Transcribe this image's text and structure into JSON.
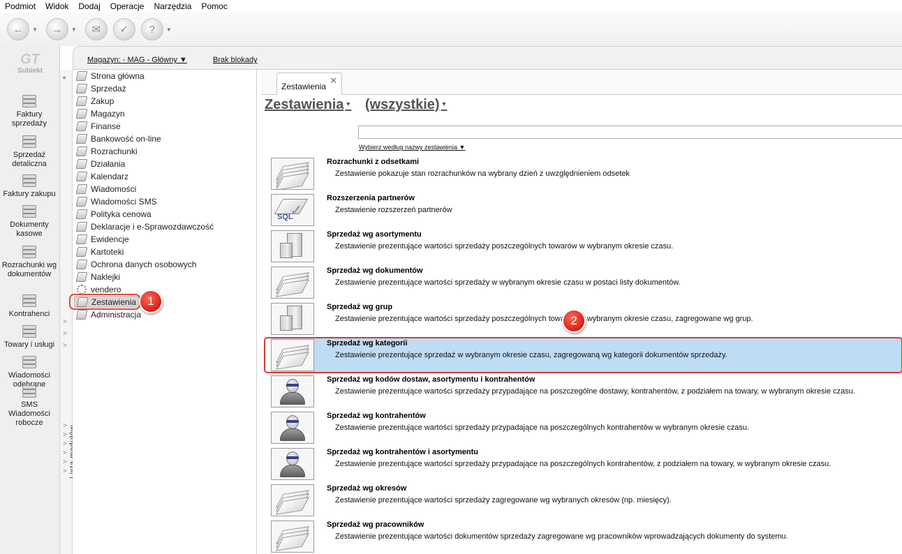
{
  "menu": [
    "Podmiot",
    "Widok",
    "Dodaj",
    "Operacje",
    "Narzędzia",
    "Pomoc"
  ],
  "toolbar": {
    "buttons": [
      {
        "icon": "back-arrow-icon"
      },
      {
        "icon": "forward-arrow-icon"
      },
      {
        "icon": "stamp-icon"
      },
      {
        "icon": "document-check-icon"
      },
      {
        "icon": "help-icon"
      }
    ]
  },
  "logo": {
    "mark": "GT",
    "name": "Subiekt"
  },
  "left_modules": [
    {
      "label": "Faktury sprzedaży",
      "icon": "invoice-stack-icon"
    },
    {
      "label": "Sprzedaż detaliczna",
      "icon": "retail-receipt-icon"
    },
    {
      "label": "Faktury zakupu",
      "icon": "purchase-invoice-icon"
    },
    {
      "label": "Dokumenty kasowe",
      "icon": "cash-documents-icon"
    },
    {
      "label": "Rozrachunki wg dokumentów",
      "icon": "settlements-icon"
    },
    {
      "label": "Kontrahenci",
      "icon": "contractors-icon"
    },
    {
      "label": "Towary i usługi",
      "icon": "goods-services-icon"
    },
    {
      "label": "Wiadomości odebrane",
      "icon": "messages-received-icon"
    },
    {
      "label": "SMS Wiadomości robocze",
      "icon": "sms-drafts-icon"
    }
  ],
  "topstrip": {
    "warehouse": "Magazyn: - MAG - Główny",
    "lock": "Brak blokady"
  },
  "vbar": {
    "label": "Lista modułów"
  },
  "module_list": [
    "Strona główna",
    "Sprzedaż",
    "Zakup",
    "Magazyn",
    "Finanse",
    "Bankowość on-line",
    "Rozrachunki",
    "Działania",
    "Kalendarz",
    "Wiadomości",
    "Wiadomości SMS",
    "Polityka cenowa",
    "Deklaracje i e-Sprawozdawczość",
    "Ewidencje",
    "Kartoteki",
    "Ochrona danych osobowych",
    "Naklejki",
    "vendero",
    "Zestawienia",
    "Administracja"
  ],
  "selected_module": "Zestawienia",
  "callouts": [
    "1",
    "2"
  ],
  "content": {
    "tab": "Zestawienia",
    "heading": "Zestawienia",
    "filter": "(wszystkie)",
    "search_value": "",
    "search_hint": "Wybierz według nazwy zestawienia",
    "selected_index": 5,
    "reports": [
      {
        "title": "Rozrachunki z odsetkami",
        "desc": "Zestawienie pokazuje stan rozrachunków na wybrany dzień z uwzględnieniem odsetek",
        "icon": "papers-stack-icon"
      },
      {
        "title": "Rozszerzenia partnerów",
        "desc": "Zestawienie rozszerzeń partnerów",
        "icon": "sql-icon"
      },
      {
        "title": "Sprzedaż wg asortymentu",
        "desc": "Zestawienie prezentujące wartości sprzedaży poszczególnych towarów w wybranym okresie czasu.",
        "icon": "boxes-icon"
      },
      {
        "title": "Sprzedaż wg dokumentów",
        "desc": "Zestawienie prezentujące wartości sprzedaży w wybranym okresie czasu w postaci listy dokumentów.",
        "icon": "paper-stack-icon"
      },
      {
        "title": "Sprzedaż wg grup",
        "desc": "Zestawienie prezentujące wartości sprzedaży poszczególnych towarów w wybranym okresie czasu, zagregowane wg grup.",
        "icon": "boxes-icon"
      },
      {
        "title": "Sprzedaż wg kategorii",
        "desc": "Zestawienie prezentujące sprzedaż w wybranym okresie czasu, zagregowaną wg kategorii dokumentów sprzedaży.",
        "icon": "paper-stack-icon"
      },
      {
        "title": "Sprzedaż wg kodów dostaw, asortymentu i kontrahentów",
        "desc": "Zestawienie prezentujące wartości sprzedaży przypadające na poszczególne dostawy, kontrahentów, z podziałem na towary, w wybranym okresie czasu.",
        "icon": "person-icon"
      },
      {
        "title": "Sprzedaż wg kontrahentów",
        "desc": "Zestawienie prezentujące wartości sprzedaży przypadające na poszczególnych kontrahentów w wybranym okresie czasu.",
        "icon": "person-icon"
      },
      {
        "title": "Sprzedaż wg kontrahentów i asortymentu",
        "desc": "Zestawienie prezentujące wartości sprzedaży przypadające na poszczególnych kontrahentów, z podziałem na towary, w wybranym okresie czasu.",
        "icon": "person-icon"
      },
      {
        "title": "Sprzedaż wg okresów",
        "desc": "Zestawienie prezentujące wartości sprzedaży zagregowane wg wybranych okresów (np. miesięcy).",
        "icon": "paper-stack-icon"
      },
      {
        "title": "Sprzedaż wg pracowników",
        "desc": "Zestawienie prezentujące wartości dokumentów sprzedaży zagregowane wg pracowników wprowadzających dokumenty do systemu.",
        "icon": "paper-stack-icon"
      }
    ]
  },
  "colors": {
    "selection": "#bfdcf5",
    "callout": "#e0382a"
  }
}
